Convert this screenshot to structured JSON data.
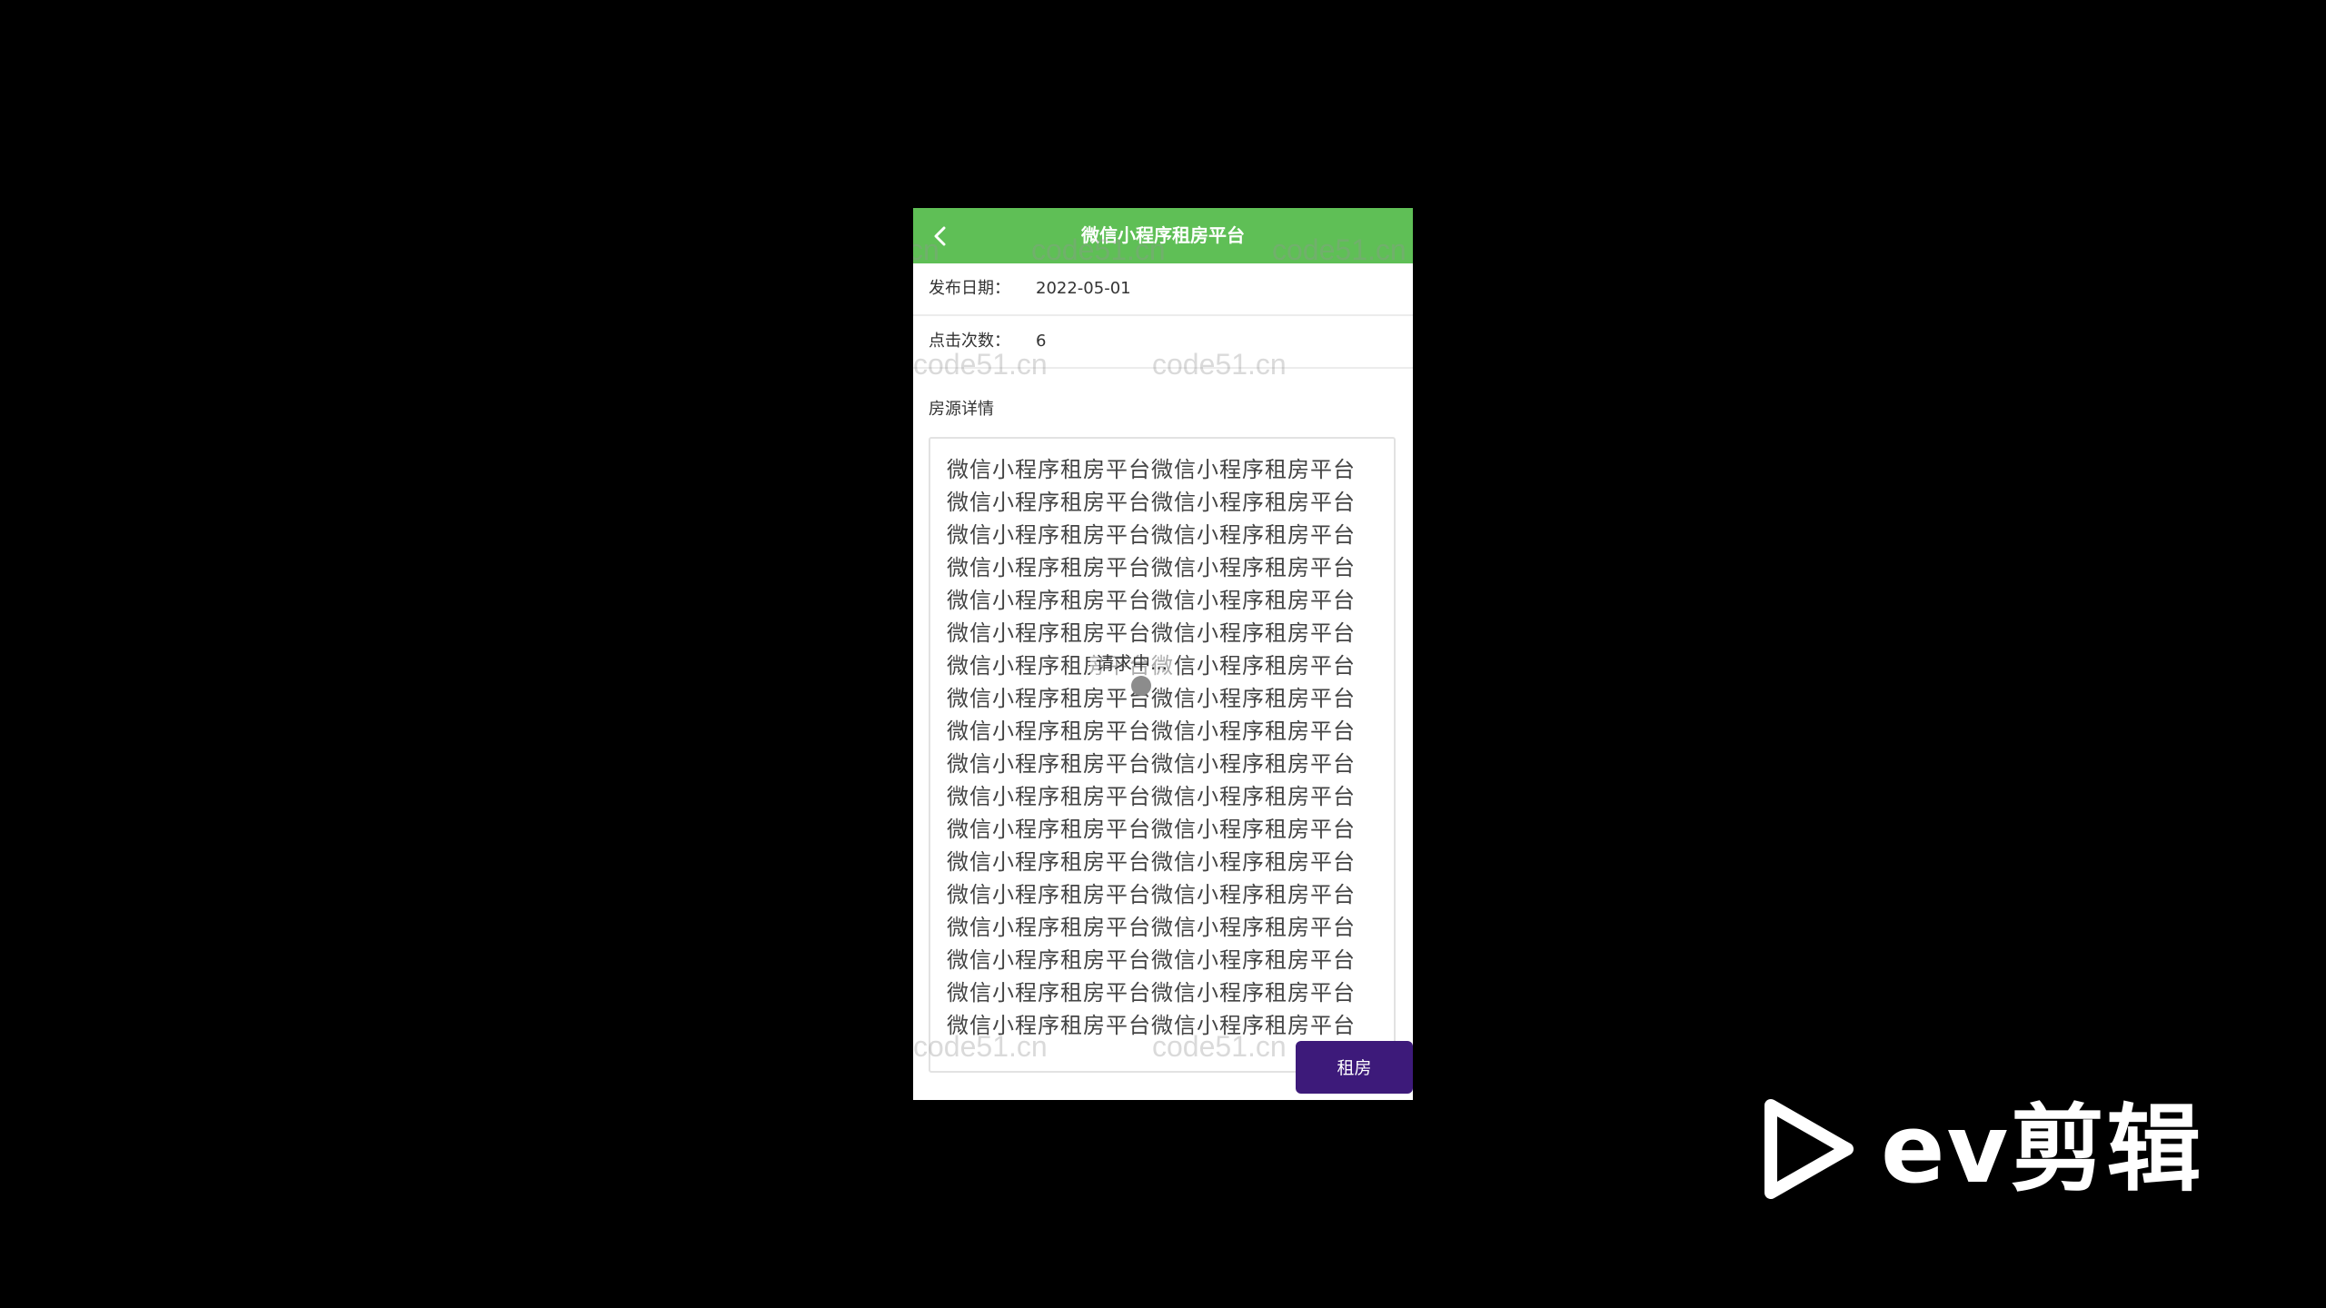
{
  "navbar": {
    "title": "微信小程序租房平台",
    "back_icon": "chevron-left-icon",
    "color": "#5fbf56"
  },
  "fields": [
    {
      "label": "发布日期：",
      "value": "2022-05-01"
    },
    {
      "label": "点击次数：",
      "value": "6"
    }
  ],
  "details": {
    "label": "房源详情",
    "lines": [
      "微信小程序租房平台微信小程序租房平台",
      "微信小程序租房平台微信小程序租房平台",
      "微信小程序租房平台微信小程序租房平台",
      "微信小程序租房平台微信小程序租房平台",
      "微信小程序租房平台微信小程序租房平台",
      "微信小程序租房平台微信小程序租房平台",
      "微信小程序租房平台微信小程序租房平台",
      "微信小程序租房平台微信小程序租房平台",
      "微信小程序租房平台微信小程序租房平台",
      "微信小程序租房平台微信小程序租房平台",
      "微信小程序租房平台微信小程序租房平台",
      "微信小程序租房平台微信小程序租房平台",
      "微信小程序租房平台微信小程序租房平台",
      "微信小程序租房平台微信小程序租房平台",
      "微信小程序租房平台微信小程序租房平台",
      "微信小程序租房平台微信小程序租房平台",
      "微信小程序租房平台微信小程序租房平台",
      "微信小程序租房平台微信小程序租房平台"
    ]
  },
  "overlay": {
    "toast_text": "请求中..."
  },
  "actions": {
    "rent_label": "租房",
    "rent_color": "#3d1a7a"
  },
  "watermark": {
    "text": "code51.cn"
  },
  "branding": {
    "logo_text": "ev剪辑",
    "logo_icon": "play-icon"
  }
}
